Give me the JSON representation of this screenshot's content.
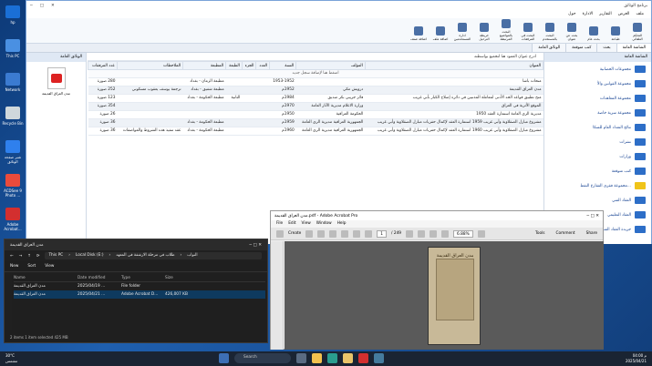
{
  "desktop": {
    "icons": [
      {
        "label": "hp",
        "color": "#1a6fd6"
      },
      {
        "label": "This PC",
        "color": "#4a90e2"
      },
      {
        "label": "Network",
        "color": "#3b7bd1"
      },
      {
        "label": "Recycle Bin",
        "color": "#cfd8dc"
      },
      {
        "label": "شير صفحة الوثائق",
        "color": "#2f80ed"
      },
      {
        "label": "ACDSee 9 Photo ...",
        "color": "#e94b3c"
      },
      {
        "label": "Adobe Acrobat...",
        "color": "#d32f2f"
      }
    ]
  },
  "app": {
    "title": "برنامج الوثائق",
    "menu": [
      "ملف",
      "العرض",
      "التقارير",
      "الادارة",
      "حول"
    ],
    "ribbon": [
      "التحكم التلقائي",
      "طباعة",
      "بحث عام",
      "بحث عن عنوان",
      "البحث بالمستخدم",
      "البحث في المرفقات",
      "البحث بالمواضيع المرتبطة",
      "خريطة الترحيل",
      "ادارة المستخدمين",
      "اضافة ملف",
      "اضافة صنف"
    ],
    "tabs": [
      "الشاشة العامة",
      "بحث",
      "كتب متوقعة",
      "الوثائق العامة"
    ],
    "left_panel_title": "الوثائق العامة",
    "pdf_label": "مدن العراق القديمة",
    "right_panel_title": "الشاشة العامة",
    "tree": [
      {
        "label": "مجموعات الحصانية",
        "selected": false
      },
      {
        "label": "مجموعة القوانين والأ",
        "selected": false
      },
      {
        "label": "مجموعة المعاهدات",
        "selected": false
      },
      {
        "label": "مجموعة سرية خاصة",
        "selected": false
      },
      {
        "label": "نتائج التعداد العام للسكا",
        "selected": false
      },
      {
        "label": "نشرات",
        "selected": false
      },
      {
        "label": "وزارات",
        "selected": false
      },
      {
        "label": "كتب متوقعة",
        "selected": false
      },
      {
        "label": "مجموعة فقرى الفقارع النفط...",
        "selected": true
      },
      {
        "label": "العقاد الفني",
        "selected": false
      },
      {
        "label": "العقاد التعليمي",
        "selected": false
      },
      {
        "label": "جريدة العقاد الفني",
        "selected": false
      }
    ],
    "grid_hint": "ادرج عنوان العمود هنا لتجميع بواسطته",
    "columns": [
      "العنوان",
      "المؤلف",
      "السنة",
      "العدد",
      "الجزء",
      "الطبعة",
      "المطبعة",
      "الملاحظات",
      "عدد المرفقات"
    ],
    "add_row": "اضغط هنا لإضافة سجل جديد",
    "rows": [
      [
        "منحات باشا",
        "",
        "1953-1952",
        "",
        "",
        "",
        "مطبعة الزمان - بغداد",
        "",
        "280 صورة"
      ],
      [
        "مدن العراق القديمة",
        "درويش مكي",
        "1952م",
        "",
        "",
        "",
        "مطبعة شفيق - بغداد",
        "ترجمة يوسف يعقوب مسكوني",
        "252 صورة"
      ],
      [
        "منح تطبيق قواعد الحد الأدنى لمعاملة المذنبين في دائرة إصلاح الكبار بأبي غريب",
        "فائز جريبي بكر صديق",
        "1984م",
        "",
        "",
        "الثانية",
        "مطبعة الحكومة - بغداد",
        "",
        "123 صورة"
      ],
      [
        "الموقع الأثرية في العراق",
        "وزارة الاعلام مديرية الآثار العامة",
        "1970م",
        "",
        "",
        "",
        "",
        "",
        "354 صورة"
      ],
      [
        "مديرية الري العامة استمارة العقد 1950",
        "الحكومة العراقية",
        "1950م",
        "",
        "",
        "",
        "",
        "",
        "26 صورة"
      ],
      [
        "مشروع مبازل الصقلاوية وأبي غريب 1959 استمارة العقد لإكمال حفريات مبازل الصقلاوية وأبي غريب",
        "الجمهورية العراقية مديرية الري العامة",
        "1959م",
        "",
        "",
        "",
        "مطبعة الحكومة - بغداد",
        "",
        "36 صورة"
      ],
      [
        "مشروع مبازل الصقلاوية وأبي غريب 1960 استمارة العقد لإكمال حفريات مبازل الصقلاوية وأبي غريب",
        "الجمهورية العراقية مديرية الري العامة",
        "1960م",
        "",
        "",
        "",
        "مطبعة الحكومة - بغداد",
        "عقد تنفيذ هذه الشروط والمواصفات",
        "36 صورة"
      ]
    ]
  },
  "explorer": {
    "tab_title": "مدن العراق القديمة",
    "path": [
      "This PC",
      "Local Disk (E:)",
      "طلاب في مرحلة الارشفة في المعهد",
      "النواب"
    ],
    "toolbar": [
      "New",
      "Sort",
      "View"
    ],
    "headers": [
      "Name",
      "Date modified",
      "Type",
      "Size"
    ],
    "files": [
      {
        "name": "مدن العراق القديمة",
        "date": "2025/04/19 ...",
        "type": "File folder",
        "size": ""
      },
      {
        "name": "مدن العراق القديمة",
        "date": "2025/04/21 ...",
        "type": "Adobe Acrobat D...",
        "size": "426,007 KB"
      }
    ],
    "status": "2 items   1 item selected  425 MB"
  },
  "acrobat": {
    "title": "مدن العراق القديمة.pdf - Adobe Acrobat Pro",
    "menu": [
      "File",
      "Edit",
      "View",
      "Window",
      "Help"
    ],
    "create": "Create",
    "page": "1",
    "pages": "/ 249",
    "zoom": "6.88%",
    "right_tools": [
      "Tools",
      "Comment",
      "Share"
    ],
    "cover_title": "مدن العراق القديمة"
  },
  "taskbar": {
    "temp": "30°C",
    "weather": "مشمس",
    "search": "Search",
    "time": "04:00 م",
    "date": "2025/04/21"
  }
}
